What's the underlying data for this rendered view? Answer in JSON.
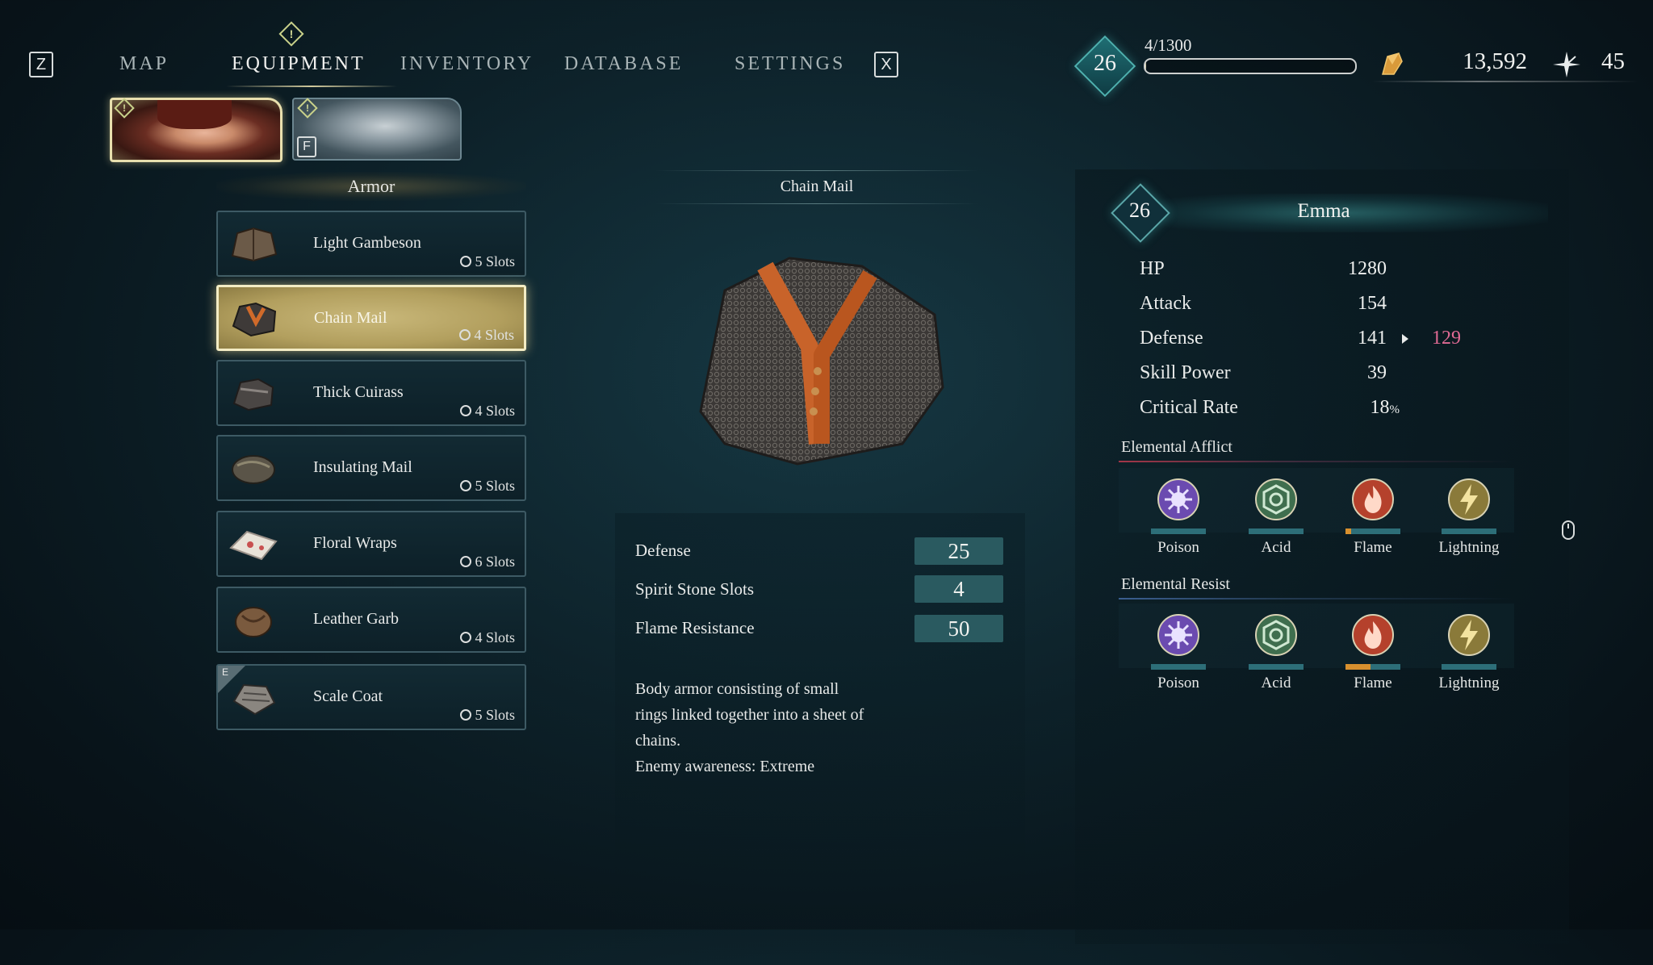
{
  "nav": {
    "left_key": "Z",
    "right_key": "X",
    "tabs": [
      {
        "label": "MAP"
      },
      {
        "label": "EQUIPMENT"
      },
      {
        "label": "INVENTORY"
      },
      {
        "label": "DATABASE"
      },
      {
        "label": "SETTINGS"
      }
    ],
    "active_tab": "EQUIPMENT",
    "alert_glyph": "!"
  },
  "status": {
    "level": "26",
    "xp_text": "4/1300",
    "xp_fraction": 0.003,
    "currency": "13,592",
    "currency_icon": "crystal-shard-icon",
    "secondary": "45",
    "secondary_icon": "feather-star-icon"
  },
  "party": {
    "companion_key": "F",
    "alert_glyph": "!"
  },
  "armor_list": {
    "title": "Armor",
    "items": [
      {
        "name": "Light Gambeson",
        "slots": "5 Slots"
      },
      {
        "name": "Chain Mail",
        "slots": "4 Slots",
        "selected": true
      },
      {
        "name": "Thick Cuirass",
        "slots": "4 Slots"
      },
      {
        "name": "Insulating Mail",
        "slots": "5 Slots"
      },
      {
        "name": "Floral Wraps",
        "slots": "6 Slots"
      },
      {
        "name": "Leather Garb",
        "slots": "4 Slots"
      },
      {
        "name": "Scale Coat",
        "slots": "5 Slots",
        "equipped_tag": "E"
      }
    ]
  },
  "detail": {
    "title": "Chain Mail",
    "stats": [
      {
        "label": "Defense",
        "value": "25"
      },
      {
        "label": "Spirit Stone Slots",
        "value": "4"
      },
      {
        "label": "Flame Resistance",
        "value": "50"
      }
    ],
    "description_lines": [
      "Body armor consisting of small",
      "rings linked together into a sheet of",
      "chains.",
      "Enemy awareness: Extreme"
    ]
  },
  "character": {
    "level": "26",
    "name": "Emma",
    "stats": [
      {
        "label": "HP",
        "value": "1280"
      },
      {
        "label": "Attack",
        "value": "154"
      },
      {
        "label": "Defense",
        "value": "141",
        "preview": "129",
        "preview_color": "#e06a94"
      },
      {
        "label": "Skill Power",
        "value": "39"
      },
      {
        "label": "Critical Rate",
        "value": "18",
        "unit": "%"
      }
    ],
    "afflict": {
      "title": "Elemental Afflict",
      "elements": [
        {
          "name": "Poison",
          "icon": "poison-icon",
          "level": 0,
          "color": "#6b4bb0"
        },
        {
          "name": "Acid",
          "icon": "acid-icon",
          "level": 0,
          "color": "#3f6e4e"
        },
        {
          "name": "Flame",
          "icon": "flame-icon",
          "level": 0.1,
          "color": "#b5412c"
        },
        {
          "name": "Lightning",
          "icon": "lightning-icon",
          "level": 0,
          "color": "#8a7a3a"
        }
      ]
    },
    "resist": {
      "title": "Elemental Resist",
      "elements": [
        {
          "name": "Poison",
          "icon": "poison-icon",
          "level": 0,
          "color": "#6b4bb0"
        },
        {
          "name": "Acid",
          "icon": "acid-icon",
          "level": 0,
          "color": "#3f6e4e"
        },
        {
          "name": "Flame",
          "icon": "flame-icon",
          "level": 0.45,
          "color": "#b5412c"
        },
        {
          "name": "Lightning",
          "icon": "lightning-icon",
          "level": 0,
          "color": "#8a7a3a"
        }
      ]
    }
  }
}
